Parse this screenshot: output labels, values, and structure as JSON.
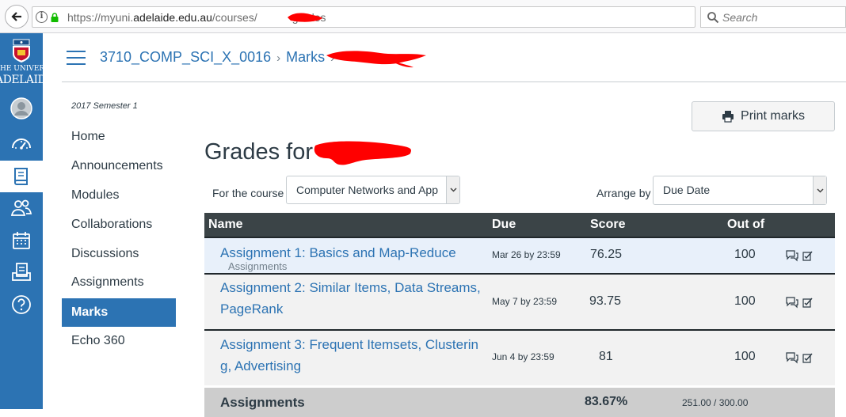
{
  "browser": {
    "url_prefix": "https://myuni.",
    "url_host": "adelaide.edu.au",
    "url_path": "/courses/",
    "url_suffix": "grades",
    "search_placeholder": "Search"
  },
  "logo": {
    "line1": "THE UNIVERSITY",
    "line2": "ADELAIDE"
  },
  "global_nav": {
    "icons": [
      "account-icon",
      "dashboard-icon",
      "courses-icon",
      "groups-icon",
      "calendar-icon",
      "inbox-icon",
      "help-icon"
    ]
  },
  "breadcrumb": {
    "course": "3710_COMP_SCI_X_0016",
    "separator": "›",
    "section": "Marks",
    "separator2": "›"
  },
  "course_nav": {
    "term": "2017 Semester 1",
    "items": [
      {
        "label": "Home"
      },
      {
        "label": "Announcements"
      },
      {
        "label": "Modules"
      },
      {
        "label": "Collaborations"
      },
      {
        "label": "Discussions"
      },
      {
        "label": "Assignments"
      },
      {
        "label": "Marks",
        "active": true
      },
      {
        "label": "Echo 360"
      }
    ]
  },
  "main": {
    "print_label": "Print marks",
    "title_prefix": "Grades for",
    "course_label": "For the course",
    "course_value": "Computer Networks and App",
    "arrange_label": "Arrange by",
    "arrange_value": "Due Date"
  },
  "table": {
    "headers": {
      "name": "Name",
      "due": "Due",
      "score": "Score",
      "out_of": "Out of"
    },
    "rows": [
      {
        "name_line1": "Assignment 1: Basics and Map-Reduce",
        "name_line2": "",
        "group": "Assignments",
        "due": "Mar 26 by 23:59",
        "score": "76.25",
        "out_of": "100"
      },
      {
        "name_line1": "Assignment 2: Similar Items, Data Streams,",
        "name_line2": "PageRank",
        "group": "",
        "due": "May 7 by 23:59",
        "score": "93.75",
        "out_of": "100"
      },
      {
        "name_line1": "Assignment 3: Frequent Itemsets, Clusterin",
        "name_line2": "g, Advertising",
        "group": "",
        "due": "Jun 4 by 23:59",
        "score": "81",
        "out_of": "100"
      }
    ],
    "total": {
      "label": "Assignments",
      "percent": "83.67%",
      "fraction": "251.00 / 300.00"
    }
  },
  "colors": {
    "nav_blue": "#2c73b3",
    "link_blue": "#2c73b3",
    "table_header": "#3b4447",
    "redaction": "#ff0000"
  }
}
